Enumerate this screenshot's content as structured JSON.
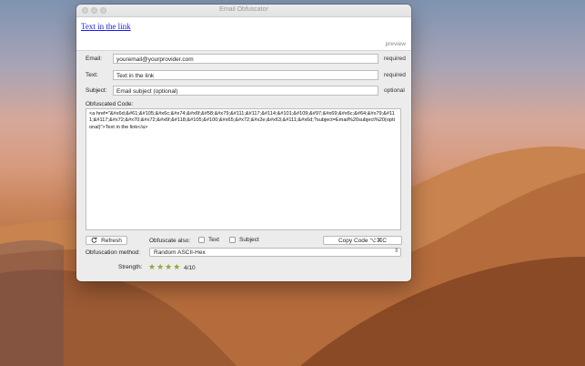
{
  "window": {
    "title": "Email Obfuscator"
  },
  "preview": {
    "link_text": "Text in the link",
    "label": "preview"
  },
  "form": {
    "email": {
      "label": "Email:",
      "value": "youremail@yourprovider.com",
      "note": "required"
    },
    "text": {
      "label": "Text:",
      "value": "Text in the link",
      "note": "required"
    },
    "subject": {
      "label": "Subject:",
      "placeholder": "Email subject (optional)",
      "note": "optional"
    }
  },
  "code": {
    "label": "Obfuscated Code:",
    "value": "<a href=\"&#x6d;&#61;&#105;&#x6c;&#x74;&#x6f;&#58;&#x79;&#111;&#117;&#114;&#101;&#109;&#97;&#x69;&#x6c;&#64;&#x79;&#111;&#117;&#x72;&#x70;&#x72;&#x6f;&#118;&#105;&#100;&#x65;&#x72;&#x2e;&#x63;&#111;&#x6d;?subject=Email%20subject%20(optional)\">Text in the link</a>"
  },
  "controls": {
    "refresh_label": "Refresh",
    "obfuscate_also_label": "Obfuscate also:",
    "text_checkbox_label": "Text",
    "subject_checkbox_label": "Subject",
    "copy_label": "Copy Code  ⌥⌘C",
    "method_label": "Obfuscation method:",
    "method_value": "Random ASCII-Hex",
    "strength_label": "Strength:",
    "strength_stars": 4,
    "strength_value": "4/10"
  },
  "colors": {
    "star": "#8ea83a",
    "link": "#1a1aee"
  }
}
